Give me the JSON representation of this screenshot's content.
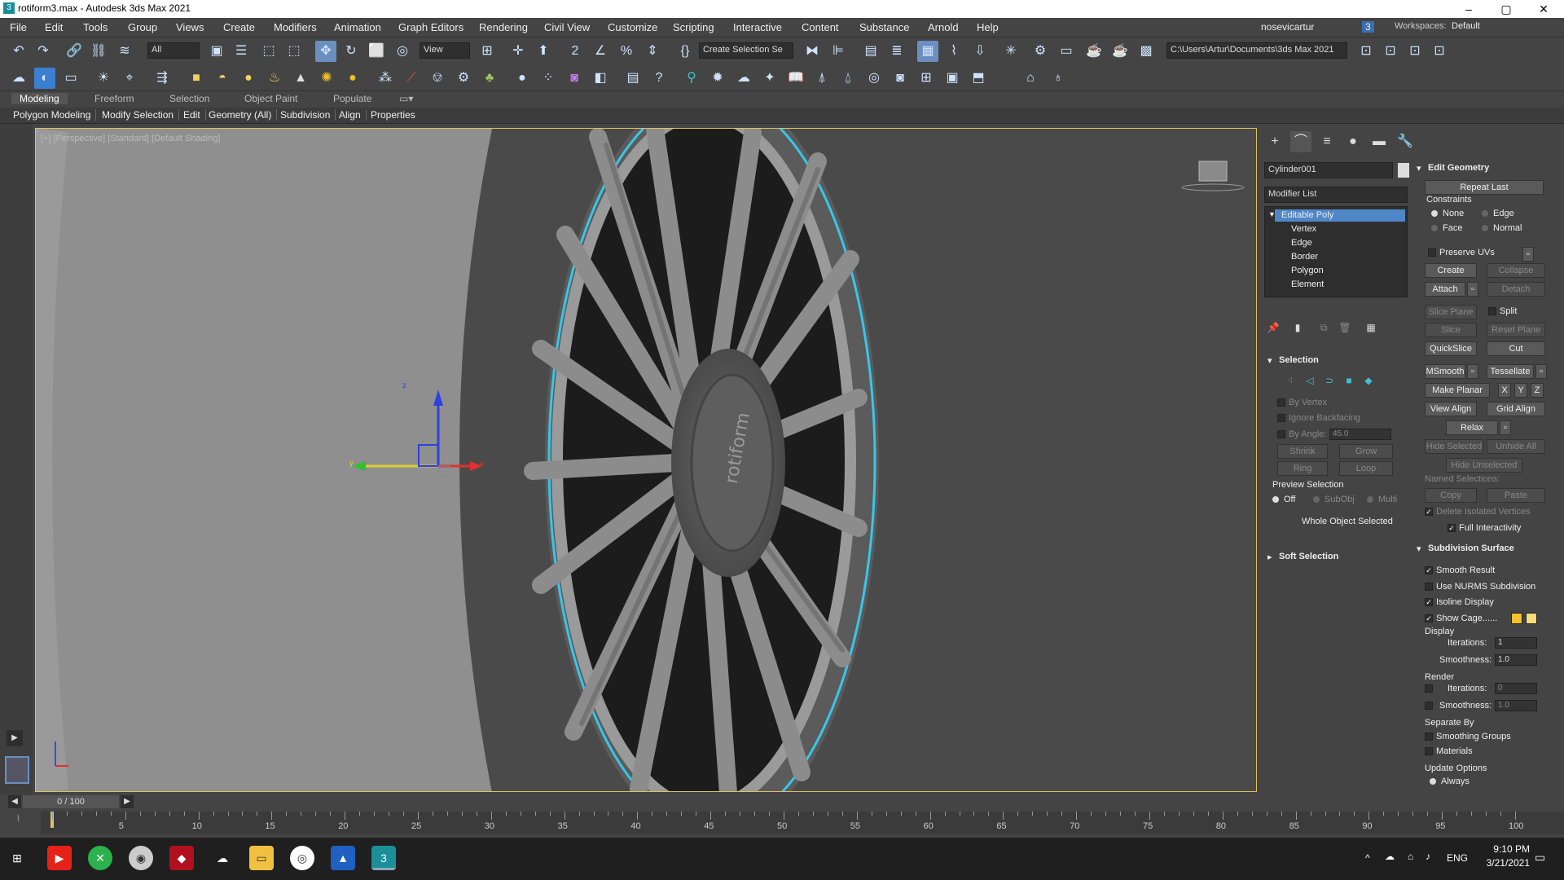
{
  "window": {
    "title": "rotiform3.max - Autodesk 3ds Max 2021",
    "app_icon": "3",
    "minimize": "–",
    "maximize": "▢",
    "close": "✕"
  },
  "menu": [
    "File",
    "Edit",
    "Tools",
    "Group",
    "Views",
    "Create",
    "Modifiers",
    "Animation",
    "Graph Editors",
    "Rendering",
    "Civil View",
    "Customize",
    "Scripting",
    "Interactive",
    "Content",
    "Substance",
    "Arnold",
    "Help"
  ],
  "account": {
    "user": "nosevicartur",
    "notifications": "3",
    "workspaces_label": "Workspaces:",
    "workspace": "Default"
  },
  "toolbar": {
    "filter": "All",
    "ref_coord": "View",
    "selection_set": "Create Selection Se",
    "project_path": "C:\\Users\\Artur\\Documents\\3ds Max 2021"
  },
  "ribbon": {
    "tabs": [
      "Modeling",
      "Freeform",
      "Selection",
      "Object Paint",
      "Populate"
    ],
    "sub": [
      "Polygon Modeling",
      "Modify Selection",
      "Edit",
      "Geometry (All)",
      "Subdivision",
      "Align",
      "Properties"
    ]
  },
  "viewport": {
    "label": "[+] [Perspective] [Standard] [Default Shading]",
    "axis_x": "x",
    "axis_y": "y",
    "axis_z": "z",
    "brand_text": "rotiform"
  },
  "command_panel": {
    "object_name": "Cylinder001",
    "modifier_list": "Modifier List",
    "stack": [
      "Editable Poly",
      "Vertex",
      "Edge",
      "Border",
      "Polygon",
      "Element"
    ],
    "selection": {
      "title": "Selection",
      "by_vertex": "By Vertex",
      "ignore_backfacing": "Ignore Backfacing",
      "by_angle": "By Angle:",
      "angle_value": "45.0",
      "shrink": "Shrink",
      "grow": "Grow",
      "ring": "Ring",
      "loop": "Loop",
      "preview_title": "Preview Selection",
      "off": "Off",
      "subobj": "SubObj",
      "multi": "Multi",
      "status": "Whole Object Selected"
    },
    "soft_selection": "Soft Selection"
  },
  "edit_geometry": {
    "title": "Edit Geometry",
    "repeat_last": "Repeat Last",
    "constraints": "Constraints",
    "none": "None",
    "edge": "Edge",
    "face": "Face",
    "normal": "Normal",
    "preserve_uvs": "Preserve UVs",
    "create": "Create",
    "collapse": "Collapse",
    "attach": "Attach",
    "detach": "Detach",
    "slice_plane": "Slice Plane",
    "split": "Split",
    "slice": "Slice",
    "reset_plane": "Reset Plane",
    "quickslice": "QuickSlice",
    "cut": "Cut",
    "msmooth": "MSmooth",
    "tessellate": "Tessellate",
    "make_planar": "Make Planar",
    "x": "X",
    "y": "Y",
    "z": "Z",
    "view_align": "View Align",
    "grid_align": "Grid Align",
    "relax": "Relax",
    "hide_selected": "Hide Selected",
    "unhide_all": "Unhide All",
    "hide_unselected": "Hide Unselected",
    "named_selections": "Named Selections:",
    "copy": "Copy",
    "paste": "Paste",
    "delete_isolated": "Delete Isolated Vertices",
    "full_interactivity": "Full Interactivity"
  },
  "subdivision": {
    "title": "Subdivision Surface",
    "smooth_result": "Smooth Result",
    "use_nurms": "Use NURMS Subdivision",
    "isoline": "Isoline Display",
    "show_cage": "Show Cage......",
    "display": "Display",
    "iterations": "Iterations:",
    "iter_value": "1",
    "smoothness": "Smoothness:",
    "smooth_value": "1.0",
    "render": "Render",
    "r_iter_value": "0",
    "r_smooth_value": "1.0",
    "separate_by": "Separate By",
    "smoothing_groups": "Smoothing Groups",
    "materials": "Materials",
    "update_options": "Update Options",
    "always": "Always"
  },
  "timeline": {
    "frame": "0 / 100",
    "ticks": [
      "5",
      "10",
      "15",
      "20",
      "25",
      "30",
      "35",
      "40",
      "45",
      "50",
      "55",
      "60",
      "65",
      "70",
      "75",
      "80",
      "85",
      "90",
      "95",
      "100"
    ]
  },
  "taskbar": {
    "lang": "ENG",
    "time": "9:10 PM",
    "date": "3/21/2021"
  },
  "colors": {
    "accent": "#6a8fbf",
    "viewport_border": "#e0c060",
    "cage1": "#f2c12e",
    "cage2": "#f6dd7a"
  }
}
